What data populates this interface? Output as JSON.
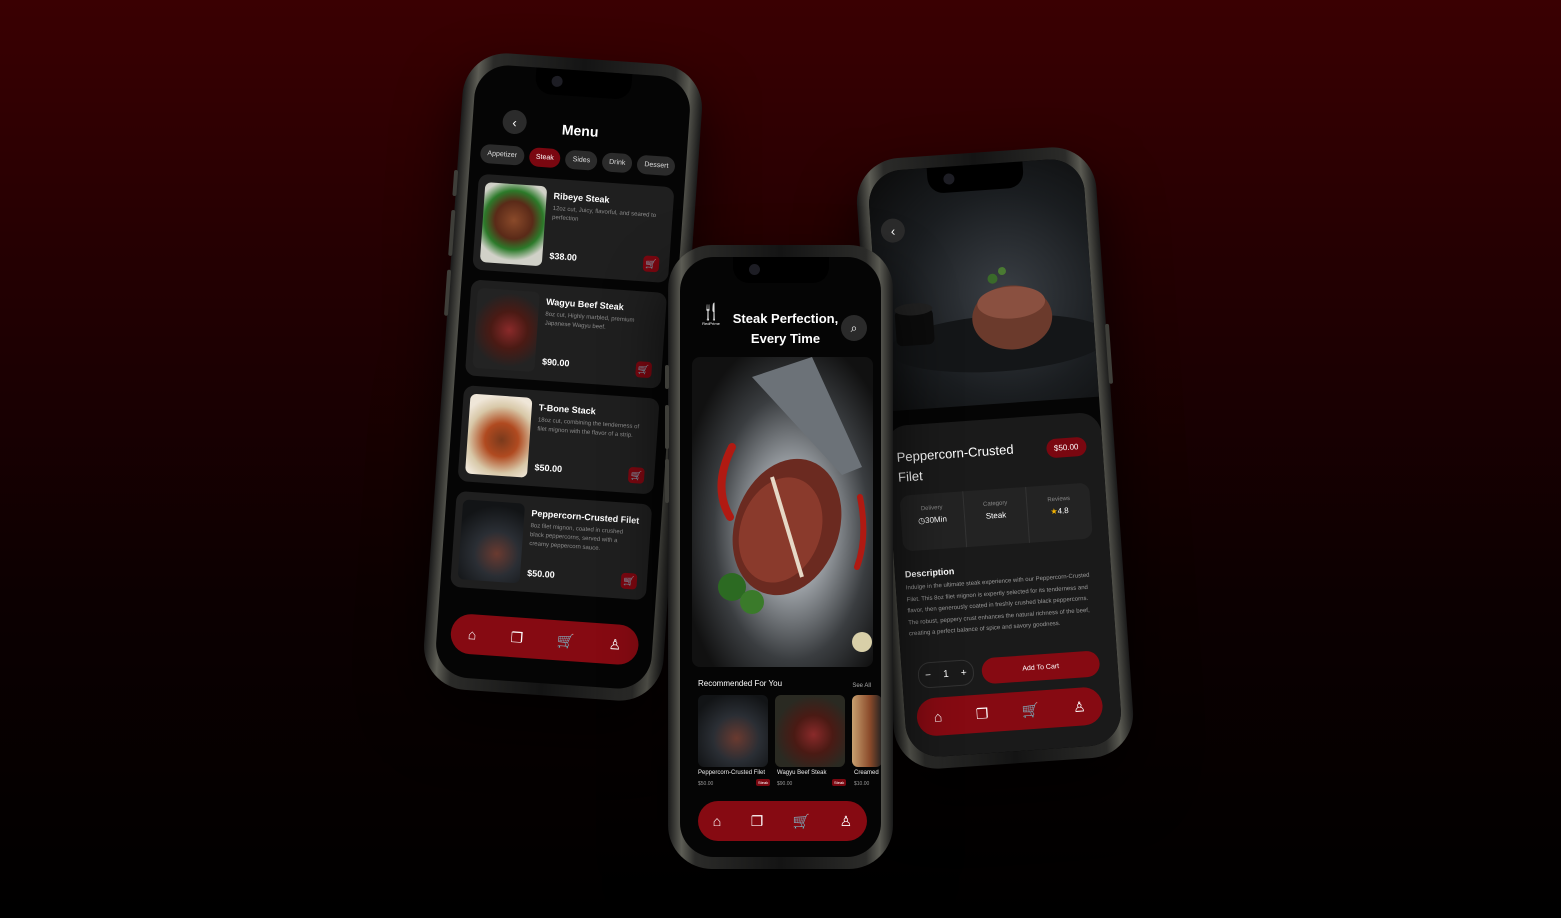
{
  "menu_screen": {
    "title": "Menu",
    "categories": [
      "Appetizer",
      "Steak",
      "Sides",
      "Drink",
      "Dessert"
    ],
    "active_category": "Steak",
    "items": [
      {
        "name": "Ribeye Steak",
        "desc": "12oz cut, Juicy, flavorful, and seared to perfection",
        "price": "$38.00"
      },
      {
        "name": "Wagyu Beef Steak",
        "desc": "8oz cut, Highly marbled, premium Japanese Wagyu beef.",
        "price": "$90.00"
      },
      {
        "name": "T-Bone Stack",
        "desc": "18oz cut, combining the tenderness of filet mignon with the flavor of a strip.",
        "price": "$50.00"
      },
      {
        "name": "Peppercorn-Crusted Filet",
        "desc": "8oz filet mignon, coated in crushed black peppercorns, served with a creamy peppercorn sauce.",
        "price": "$50.00"
      }
    ],
    "nav_icons": [
      "home-icon",
      "book-icon",
      "cart-icon",
      "user-icon"
    ]
  },
  "home_screen": {
    "logo_text": "RedPrime",
    "hero_title_line1": "Steak Perfection,",
    "hero_title_line2": "Every Time",
    "recommended_title": "Recommended For You",
    "see_all": "See All",
    "recommended": [
      {
        "name": "Peppercorn-Crusted Filet",
        "price": "$50.00",
        "tag": "Steak"
      },
      {
        "name": "Wagyu Beef Steak",
        "price": "$90.00",
        "tag": "Steak"
      },
      {
        "name": "Creamed",
        "price": "$10.00",
        "tag": ""
      }
    ]
  },
  "detail_screen": {
    "name": "Peppercorn-Crusted Filet",
    "price": "$50.00",
    "stats": {
      "delivery_label": "Delivery",
      "delivery_value": "30Min",
      "category_label": "Category",
      "category_value": "Steak",
      "reviews_label": "Reviews",
      "reviews_value": "4.8"
    },
    "description_title": "Description",
    "description": "Indulge in the ultimate steak experience with our Peppercorn-Crusted Filet. This 8oz filet mignon is expertly selected for its tenderness and flavor, then generously coated in freshly crushed black peppercorns. The robust, peppery crust enhances the natural richness of the beef, creating a perfect balance of spice and savory goodness.",
    "quantity": "1",
    "add_to_cart": "Add To Cart"
  },
  "colors": {
    "accent": "#860a12",
    "background_top": "#3a0002",
    "card": "#1f1f1f"
  }
}
